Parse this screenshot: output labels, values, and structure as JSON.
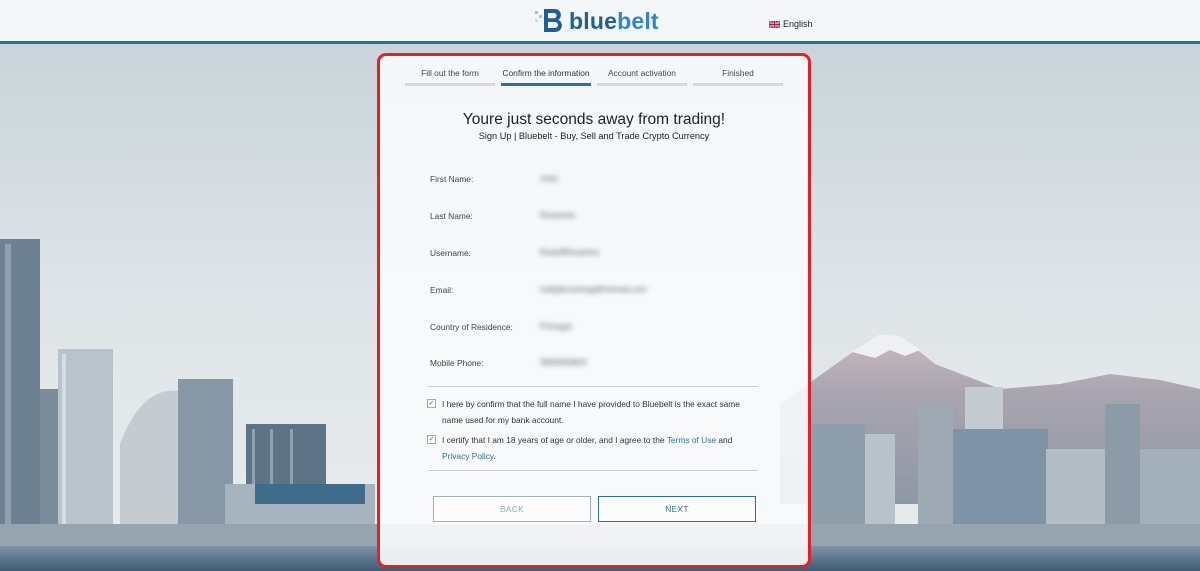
{
  "header": {
    "logo_text_part1": "blue",
    "logo_text_part2": "belt",
    "language": "English"
  },
  "steps": [
    {
      "label": "Fill out the form",
      "active": false
    },
    {
      "label": "Confirm the information",
      "active": true
    },
    {
      "label": "Account activation",
      "active": false
    },
    {
      "label": "Finished",
      "active": false
    }
  ],
  "form": {
    "title": "Youre just seconds away from trading!",
    "subtitle": "Sign Up | Bluebelt - Buy, Sell and Trade Crypto Currency",
    "fields": [
      {
        "label": "First Name:",
        "value": "Joao"
      },
      {
        "label": "Last Name:",
        "value": "Rossinha"
      },
      {
        "label": "Username:",
        "value": "RodolfRossinha"
      },
      {
        "label": "Email:",
        "value": "hollyjbrowning@hotmail.com"
      },
      {
        "label": "Country of Residence:",
        "value": "Portugal"
      },
      {
        "label": "Mobile Phone:",
        "value": "3894563823"
      }
    ],
    "confirm_name_text": "I here by confirm that the full name I have provided to Bluebelt is the exact same name used for my bank account.",
    "age_text_prefix": "I certify that I am 18 years of age or older, and I agree to the",
    "terms_link": "Terms of Use",
    "age_text_and": "and",
    "privacy_link": "Privacy Policy",
    "age_text_end": ".",
    "back_label": "BACK",
    "next_label": "NEXT"
  },
  "colors": {
    "brand_blue": "#2a6fa8",
    "highlight_border": "#e0202a"
  }
}
